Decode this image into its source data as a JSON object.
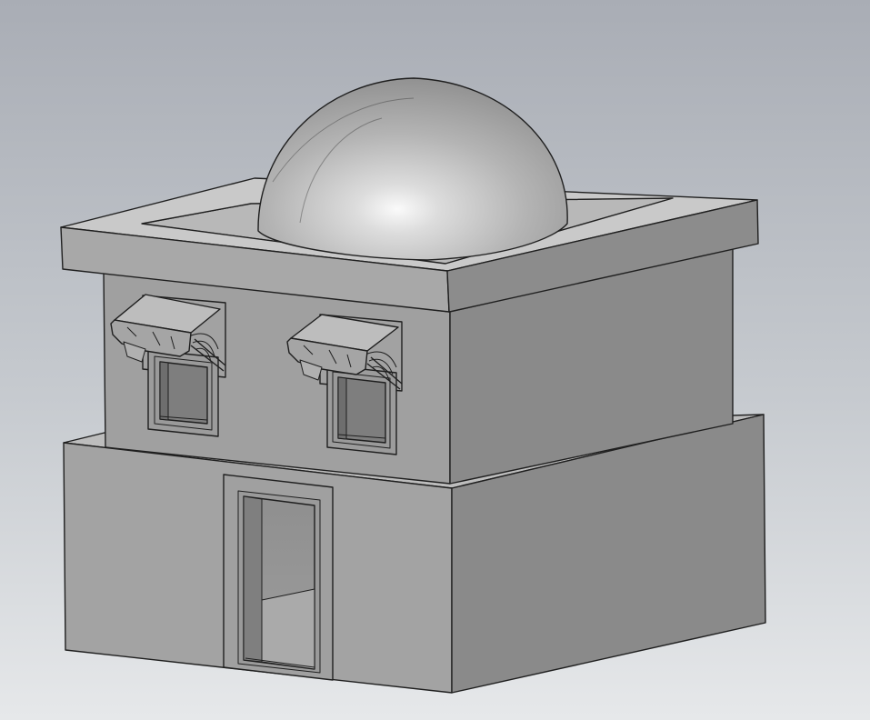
{
  "viewport": {
    "background_top": "#a9adb5",
    "background_bottom": "#e6e8ea"
  },
  "model": {
    "shade_light": "#a2a2a2",
    "shade_mid": "#9a9a9a",
    "shade_dark": "#888888",
    "shade_top": "#bdbdbd",
    "edge_color": "#1f1f1f"
  }
}
